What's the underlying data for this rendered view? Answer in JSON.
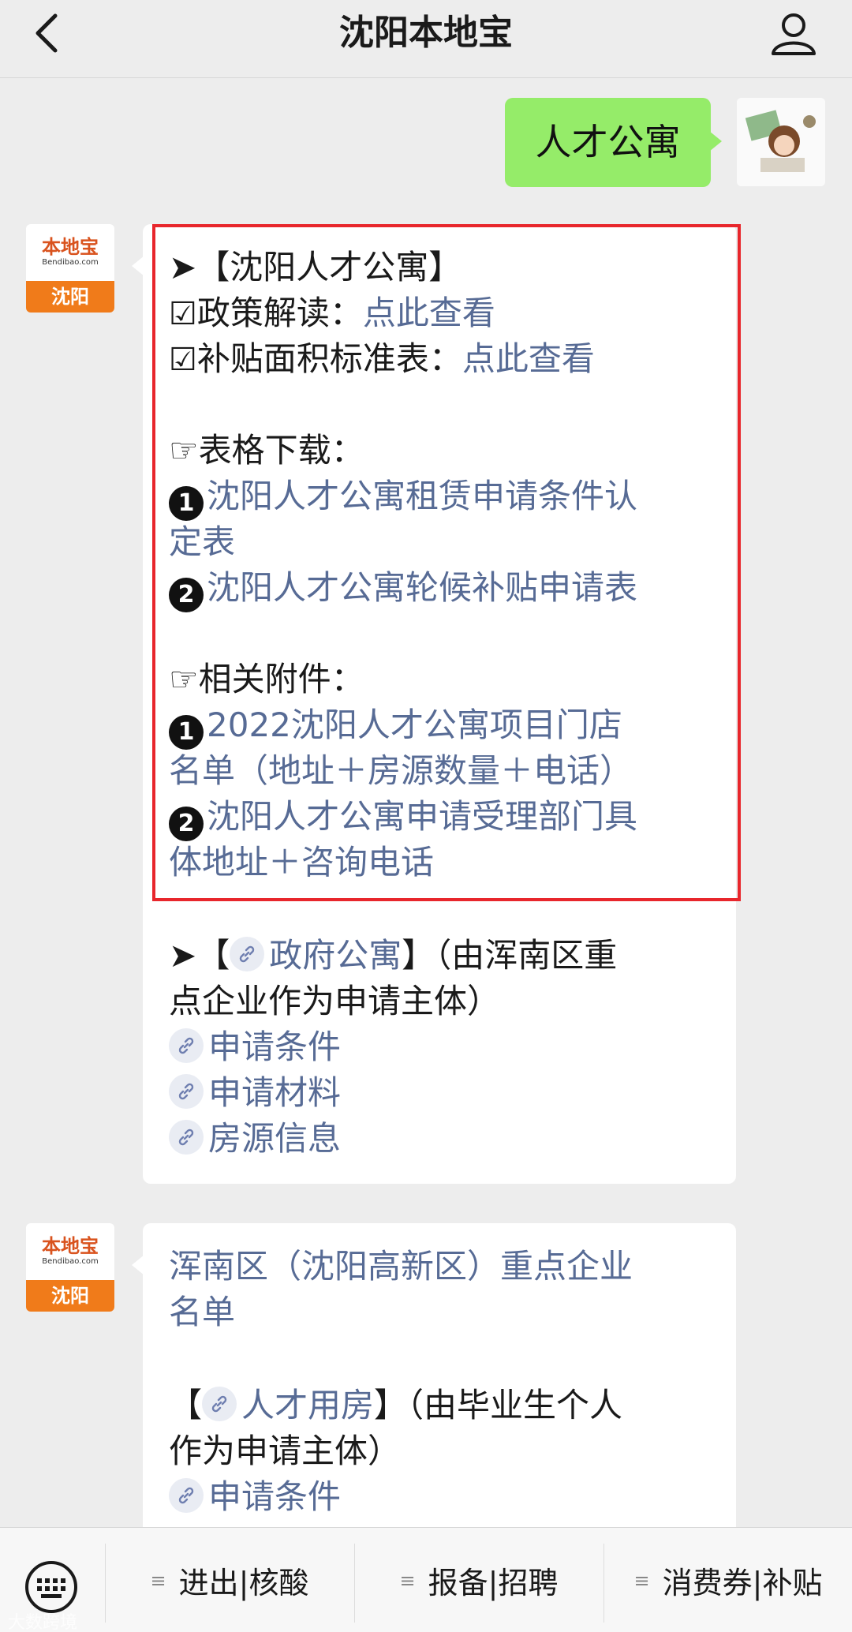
{
  "header": {
    "title": "沈阳本地宝"
  },
  "outgoing_message": "人才公寓",
  "bot_avatar": {
    "logo": "本地宝",
    "sub": "Bendibao.com",
    "city": "沈阳"
  },
  "message1": {
    "heading": "➤【沈阳人才公寓】",
    "policy_label": "政策解读：",
    "policy_link": "点此查看",
    "area_label": "补贴面积标准表：",
    "area_link": "点此查看",
    "forms_heading": "☞表格下载：",
    "form1_line1": "沈阳人才公寓租赁申请条件认",
    "form1_line2": "定表",
    "form2": "沈阳人才公寓轮候补贴申请表",
    "attach_heading": "☞相关附件：",
    "attach1_line1": "2022沈阳人才公寓项目门店",
    "attach1_line2": "名单（地址＋房源数量＋电话）",
    "attach2_line1": "沈阳人才公寓申请受理部门具",
    "attach2_line2": "体地址＋咨询电话",
    "gov_prefix": "➤【",
    "gov_link": "政府公寓",
    "gov_suffix": "】（由浑南区重",
    "gov_line2": "点企业作为申请主体）",
    "gov_items": [
      "申请条件",
      "申请材料",
      "房源信息"
    ]
  },
  "message2": {
    "line1": "浑南区（沈阳高新区）重点企业",
    "line2": "名单",
    "talent_prefix": "【",
    "talent_link": "人才用房",
    "talent_suffix": "】（由毕业生个人",
    "talent_line2": "作为申请主体）",
    "item1": "申请条件"
  },
  "bottom_menu": [
    {
      "label": "进出|核酸"
    },
    {
      "label": "报备|招聘"
    },
    {
      "label": "消费券|补贴"
    }
  ],
  "watermark": "大数跨境"
}
